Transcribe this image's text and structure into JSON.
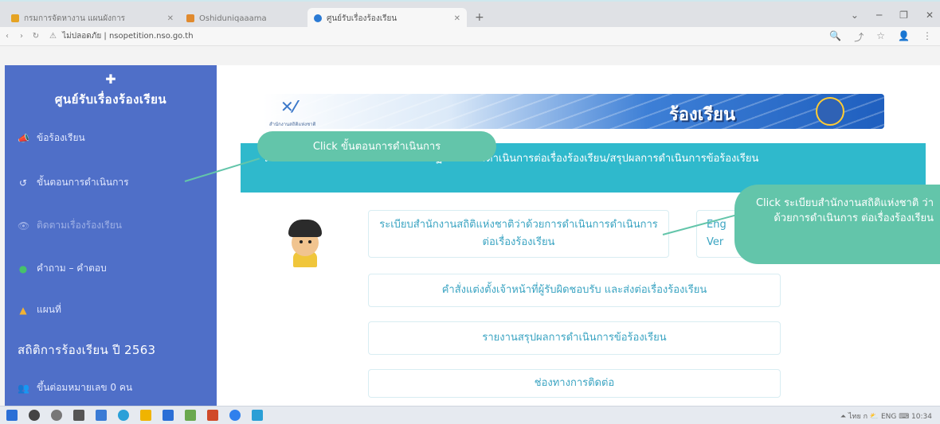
{
  "browser": {
    "tabs": [
      {
        "label": "กรมการจัดหางาน แผนผังการ",
        "favicon_color": "#e5a323"
      },
      {
        "label": "Oshiduniqaaama",
        "favicon_color": "#e08a2e"
      },
      {
        "label": "ศูนย์รับเรื่องร้องเรียน",
        "favicon_color": "#2a7ad4"
      }
    ],
    "new_tab": "+",
    "window_controls": [
      "⌄",
      "─",
      "❐",
      "✕"
    ],
    "nav": [
      "‹",
      "›",
      "↻"
    ],
    "url_security": "ไม่ปลอดภัย",
    "url": "nsopetition.nso.go.th",
    "addr_icons": [
      "🔍",
      "⤴",
      "☆",
      "👤",
      "⋮"
    ]
  },
  "sidebar": {
    "brand_title": "ศูนย์รับเรื่องร้องเรียน",
    "items": [
      {
        "label": "ข้อร้องเรียน",
        "icon": "megaphone-icon",
        "glyph": "📣"
      },
      {
        "label": "ขั้นตอนการดำเนินการ",
        "icon": "history-icon",
        "glyph": "↺"
      },
      {
        "label": "ติดตามเรื่องร้องเรียน",
        "icon": "eye-icon",
        "glyph": "👁"
      },
      {
        "label": "คำถาม – คำตอบ",
        "icon": "question-icon",
        "glyph": "●"
      },
      {
        "label": "แผนที่",
        "icon": "map-icon",
        "glyph": "▲"
      }
    ],
    "stats_title": "สถิติการร้องเรียน ปี 2563",
    "online_users": "ขึ้นต่อมหมายเลข 0 คน"
  },
  "main": {
    "banner_title": "ร้องเรียน",
    "banner_subtitle": "สำนักงานสถิติแห่งชาติ",
    "section_header": "ระเบียบกระบวนการที่เกี่ยวข้องกับการปฏิบัติต่อการดำเนินการต่อเรื่องร้องเรียน/สรุปผลการดำเนินการข้อร้องเรียน",
    "links": {
      "regulation": "ระเบียบสำนักงานสถิติแห่งชาติว่าด้วยการดำเนินการดำเนินการต่อเรื่องร้องเรียน",
      "english": "Eng\nVer",
      "order": "คำสั่งแต่งตั้งเจ้าหน้าที่ผู้รับผิดชอบรับ และส่งต่อเรื่องร้องเรียน",
      "report": "รายงานสรุปผลการดำเนินการข้อร้องเรียน",
      "contact": "ช่องทางการติดต่อ"
    }
  },
  "callouts": {
    "step": "Click ขั้นตอนการดำเนินการ",
    "regulation": "Click ระเบียบสำนักงานสถิติแห่งชาติ ว่าด้วยการดำเนินการ ต่อเรื่องร้องเรียน"
  },
  "taskbar": {
    "icon_colors": [
      "#2a6fd6",
      "#444",
      "#777",
      "#555",
      "#3a7bd5",
      "#2aa0d8",
      "#f0b400",
      "#2b6fd6",
      "#6aa84f",
      "#d04a2a",
      "#2f80ed",
      "#2a9fd6"
    ],
    "tray": "⏶ ไทย  ก  ⛅  ENG  ⌨  10:34"
  },
  "colors": {
    "sidebar": "#4f6fc8",
    "section_header": "#2fb9cc",
    "callout": "#63c5aa",
    "link_text": "#3aa4c2"
  }
}
